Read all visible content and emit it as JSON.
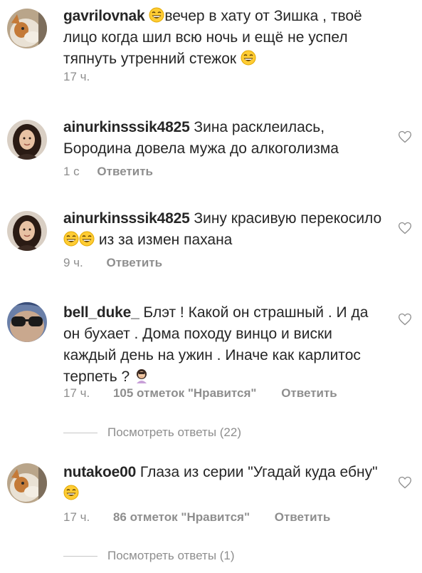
{
  "comments": [
    {
      "username": "gavrilovnak",
      "text_before_emoji": "",
      "text": "вечер в хату от Зишка , твоё лицо когда шил всю ночь и ещё не успел тяпнуть утренний стежок",
      "time": "17 ч.",
      "likes": "",
      "reply_label": "",
      "avatar": "cat-avatar"
    },
    {
      "username": "ainurkinsssik4825",
      "text": "Зина расклеилась, Бородина довела мужа до алкоголизма",
      "time": "1 с",
      "reply_label": "Ответить",
      "avatar": "woman-avatar"
    },
    {
      "username": "ainurkinsssik4825",
      "text_a": "Зину красивую перекосило",
      "text_b": "из за измен пахана",
      "time": "9 ч.",
      "reply_label": "Ответить",
      "avatar": "woman-avatar"
    },
    {
      "username": "bell_duke_",
      "text": "Блэт ! Какой он страшный . И да он бухает . Дома походу винцо и виски каждый день на ужин . Иначе как карлитос терпеть ?",
      "time": "17 ч.",
      "likes": "105 отметок \"Нравится\"",
      "reply_label": "Ответить",
      "view_replies": "Посмотреть ответы (22)",
      "avatar": "sunglasses-avatar"
    },
    {
      "username": "nutakoe00",
      "text": "Глаза из серии \"Угадай куда ебну\"",
      "time": "17 ч.",
      "likes": "86 отметок \"Нравится\"",
      "reply_label": "Ответить",
      "view_replies": "Посмотреть ответы (1)",
      "avatar": "cat-avatar"
    }
  ],
  "colors": {
    "text": "#262626",
    "meta": "#8e8e8e",
    "divider": "#c7c7c7"
  }
}
